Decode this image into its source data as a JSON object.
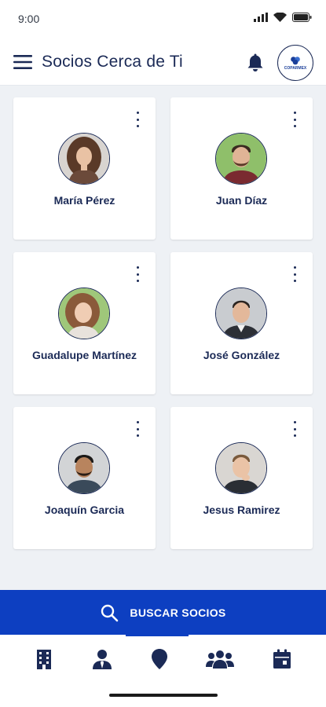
{
  "status_bar": {
    "time": "9:00"
  },
  "header": {
    "title": "Socios Cerca de Ti",
    "logo_text": "COPARMEX"
  },
  "members": [
    {
      "name": "María Pérez"
    },
    {
      "name": "Juan Díaz"
    },
    {
      "name": "Guadalupe Martínez"
    },
    {
      "name": "José González"
    },
    {
      "name": "Joaquín Garcia"
    },
    {
      "name": "Jesus Ramirez"
    }
  ],
  "search": {
    "label": "BUSCAR SOCIOS"
  },
  "bottom_nav": {
    "items": [
      {
        "icon": "building-icon"
      },
      {
        "icon": "person-tie-icon"
      },
      {
        "icon": "map-pin-icon"
      },
      {
        "icon": "group-icon"
      },
      {
        "icon": "calendar-icon"
      }
    ],
    "active_index": 2
  },
  "colors": {
    "primary_blue": "#0d3fc1",
    "navy": "#1b2a56",
    "background": "#eef1f5"
  }
}
